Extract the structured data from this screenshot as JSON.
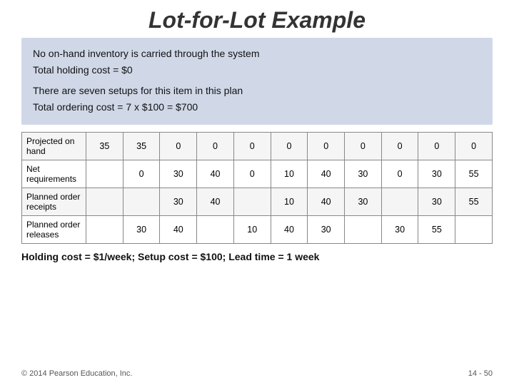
{
  "title": "Lot-for-Lot Example",
  "infobox": {
    "line1": "No on-hand inventory is carried through the system",
    "line2": "Total holding cost = $0",
    "line3": "There are seven setups for this item in this plan",
    "line4": "Total ordering cost = 7 x $100 = $700"
  },
  "table": {
    "headers": [
      "",
      "35",
      "35",
      "0",
      "0",
      "0",
      "0",
      "0",
      "0",
      "0",
      "0",
      "0"
    ],
    "rows": [
      {
        "label": "Projected on hand",
        "values": [
          "35",
          "35",
          "0",
          "0",
          "0",
          "0",
          "0",
          "0",
          "0",
          "0",
          "0"
        ]
      },
      {
        "label": "Net requirements",
        "values": [
          "",
          "0",
          "30",
          "40",
          "0",
          "10",
          "40",
          "30",
          "0",
          "30",
          "55"
        ]
      },
      {
        "label": "Planned order receipts",
        "values": [
          "",
          "",
          "30",
          "40",
          "",
          "10",
          "40",
          "30",
          "",
          "30",
          "55"
        ]
      },
      {
        "label": "Planned order releases",
        "values": [
          "",
          "30",
          "40",
          "",
          "10",
          "40",
          "30",
          "",
          "30",
          "55",
          ""
        ]
      }
    ]
  },
  "footer": "Holding cost = $1/week; Setup cost = $100; Lead time = 1 week",
  "copyright": "© 2014 Pearson Education, Inc.",
  "page_number": "14 - 50"
}
